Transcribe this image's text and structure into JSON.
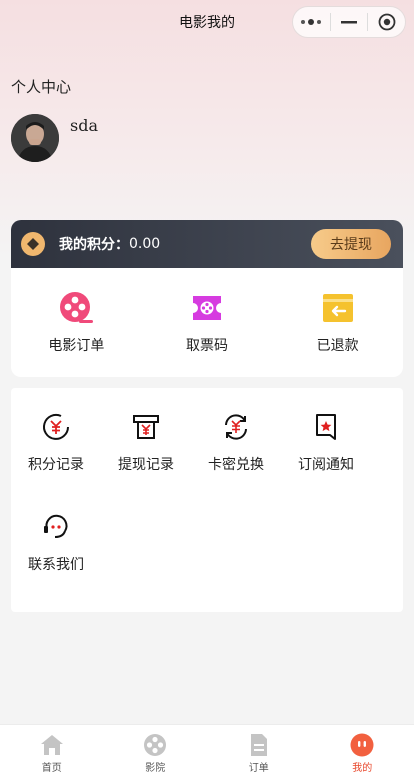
{
  "navbar": {
    "title": "电影我的"
  },
  "profile": {
    "section_label": "个人中心",
    "username": "sda"
  },
  "points": {
    "label": "我的积分：",
    "value": "0.00",
    "withdraw_label": "去提现"
  },
  "orders": {
    "items": [
      {
        "label": "电影订单",
        "icon": "film-reel-icon",
        "color": "#f04a7a"
      },
      {
        "label": "取票码",
        "icon": "ticket-icon",
        "color": "#d63be0"
      },
      {
        "label": "已退款",
        "icon": "refund-wallet-icon",
        "color": "#f5c22e"
      }
    ]
  },
  "services": {
    "items": [
      {
        "label": "积分记录",
        "icon": "yuan-coin-icon"
      },
      {
        "label": "提现记录",
        "icon": "withdraw-atm-icon"
      },
      {
        "label": "卡密兑换",
        "icon": "exchange-icon"
      },
      {
        "label": "订阅通知",
        "icon": "bookmark-icon"
      },
      {
        "label": "联系我们",
        "icon": "customer-service-icon"
      }
    ],
    "accent": "#e02020"
  },
  "tabbar": {
    "items": [
      {
        "label": "首页",
        "icon": "home-icon"
      },
      {
        "label": "影院",
        "icon": "cinema-icon"
      },
      {
        "label": "订单",
        "icon": "document-icon"
      },
      {
        "label": "我的",
        "icon": "profile-icon",
        "active": true
      }
    ],
    "active_color": "#e8472b"
  }
}
